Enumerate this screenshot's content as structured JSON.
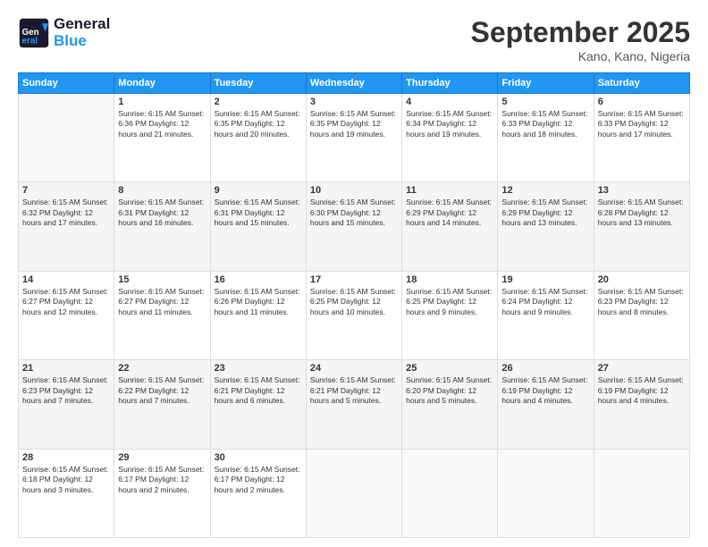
{
  "header": {
    "logo_line1": "General",
    "logo_line2": "Blue",
    "month": "September 2025",
    "location": "Kano, Kano, Nigeria"
  },
  "weekdays": [
    "Sunday",
    "Monday",
    "Tuesday",
    "Wednesday",
    "Thursday",
    "Friday",
    "Saturday"
  ],
  "weeks": [
    [
      {
        "day": "",
        "info": ""
      },
      {
        "day": "1",
        "info": "Sunrise: 6:15 AM\nSunset: 6:36 PM\nDaylight: 12 hours\nand 21 minutes."
      },
      {
        "day": "2",
        "info": "Sunrise: 6:15 AM\nSunset: 6:35 PM\nDaylight: 12 hours\nand 20 minutes."
      },
      {
        "day": "3",
        "info": "Sunrise: 6:15 AM\nSunset: 6:35 PM\nDaylight: 12 hours\nand 19 minutes."
      },
      {
        "day": "4",
        "info": "Sunrise: 6:15 AM\nSunset: 6:34 PM\nDaylight: 12 hours\nand 19 minutes."
      },
      {
        "day": "5",
        "info": "Sunrise: 6:15 AM\nSunset: 6:33 PM\nDaylight: 12 hours\nand 18 minutes."
      },
      {
        "day": "6",
        "info": "Sunrise: 6:15 AM\nSunset: 6:33 PM\nDaylight: 12 hours\nand 17 minutes."
      }
    ],
    [
      {
        "day": "7",
        "info": "Sunrise: 6:15 AM\nSunset: 6:32 PM\nDaylight: 12 hours\nand 17 minutes."
      },
      {
        "day": "8",
        "info": "Sunrise: 6:15 AM\nSunset: 6:31 PM\nDaylight: 12 hours\nand 16 minutes."
      },
      {
        "day": "9",
        "info": "Sunrise: 6:15 AM\nSunset: 6:31 PM\nDaylight: 12 hours\nand 15 minutes."
      },
      {
        "day": "10",
        "info": "Sunrise: 6:15 AM\nSunset: 6:30 PM\nDaylight: 12 hours\nand 15 minutes."
      },
      {
        "day": "11",
        "info": "Sunrise: 6:15 AM\nSunset: 6:29 PM\nDaylight: 12 hours\nand 14 minutes."
      },
      {
        "day": "12",
        "info": "Sunrise: 6:15 AM\nSunset: 6:29 PM\nDaylight: 12 hours\nand 13 minutes."
      },
      {
        "day": "13",
        "info": "Sunrise: 6:15 AM\nSunset: 6:28 PM\nDaylight: 12 hours\nand 13 minutes."
      }
    ],
    [
      {
        "day": "14",
        "info": "Sunrise: 6:15 AM\nSunset: 6:27 PM\nDaylight: 12 hours\nand 12 minutes."
      },
      {
        "day": "15",
        "info": "Sunrise: 6:15 AM\nSunset: 6:27 PM\nDaylight: 12 hours\nand 11 minutes."
      },
      {
        "day": "16",
        "info": "Sunrise: 6:15 AM\nSunset: 6:26 PM\nDaylight: 12 hours\nand 11 minutes."
      },
      {
        "day": "17",
        "info": "Sunrise: 6:15 AM\nSunset: 6:25 PM\nDaylight: 12 hours\nand 10 minutes."
      },
      {
        "day": "18",
        "info": "Sunrise: 6:15 AM\nSunset: 6:25 PM\nDaylight: 12 hours\nand 9 minutes."
      },
      {
        "day": "19",
        "info": "Sunrise: 6:15 AM\nSunset: 6:24 PM\nDaylight: 12 hours\nand 9 minutes."
      },
      {
        "day": "20",
        "info": "Sunrise: 6:15 AM\nSunset: 6:23 PM\nDaylight: 12 hours\nand 8 minutes."
      }
    ],
    [
      {
        "day": "21",
        "info": "Sunrise: 6:15 AM\nSunset: 6:23 PM\nDaylight: 12 hours\nand 7 minutes."
      },
      {
        "day": "22",
        "info": "Sunrise: 6:15 AM\nSunset: 6:22 PM\nDaylight: 12 hours\nand 7 minutes."
      },
      {
        "day": "23",
        "info": "Sunrise: 6:15 AM\nSunset: 6:21 PM\nDaylight: 12 hours\nand 6 minutes."
      },
      {
        "day": "24",
        "info": "Sunrise: 6:15 AM\nSunset: 6:21 PM\nDaylight: 12 hours\nand 5 minutes."
      },
      {
        "day": "25",
        "info": "Sunrise: 6:15 AM\nSunset: 6:20 PM\nDaylight: 12 hours\nand 5 minutes."
      },
      {
        "day": "26",
        "info": "Sunrise: 6:15 AM\nSunset: 6:19 PM\nDaylight: 12 hours\nand 4 minutes."
      },
      {
        "day": "27",
        "info": "Sunrise: 6:15 AM\nSunset: 6:19 PM\nDaylight: 12 hours\nand 4 minutes."
      }
    ],
    [
      {
        "day": "28",
        "info": "Sunrise: 6:15 AM\nSunset: 6:18 PM\nDaylight: 12 hours\nand 3 minutes."
      },
      {
        "day": "29",
        "info": "Sunrise: 6:15 AM\nSunset: 6:17 PM\nDaylight: 12 hours\nand 2 minutes."
      },
      {
        "day": "30",
        "info": "Sunrise: 6:15 AM\nSunset: 6:17 PM\nDaylight: 12 hours\nand 2 minutes."
      },
      {
        "day": "",
        "info": ""
      },
      {
        "day": "",
        "info": ""
      },
      {
        "day": "",
        "info": ""
      },
      {
        "day": "",
        "info": ""
      }
    ]
  ]
}
